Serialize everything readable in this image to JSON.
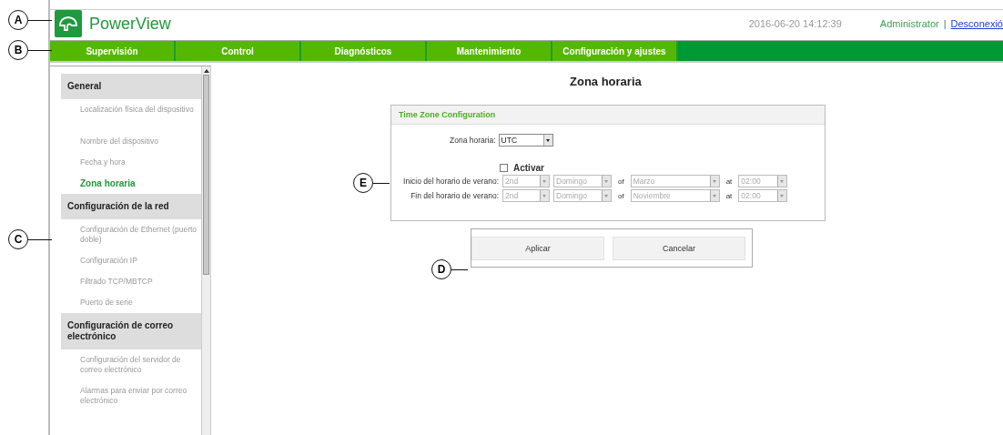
{
  "callouts": [
    "A",
    "B",
    "C",
    "D",
    "E"
  ],
  "header": {
    "brand": "PowerView",
    "datetime": "2016-06-20 14:12:39",
    "user": "Administrator",
    "separator": "|",
    "logout": "Desconexió"
  },
  "nav": [
    "Supervisión",
    "Control",
    "Diagnósticos",
    "Mantenimiento",
    "Configuración y ajustes"
  ],
  "sidebar": {
    "groups": [
      {
        "title": "General",
        "items": [
          {
            "label": "Localización física del dispositivo",
            "selected": false
          },
          {
            "label": "Nombre del dispositivo",
            "selected": false
          },
          {
            "label": "Fecha y hora",
            "selected": false
          },
          {
            "label": "Zona horaria",
            "selected": true
          }
        ]
      },
      {
        "title": "Configuración de la red",
        "items": [
          {
            "label": "Configuración de Ethernet (puerto doble)",
            "selected": false
          },
          {
            "label": "Configuración IP",
            "selected": false
          },
          {
            "label": "Filtrado TCP/MBTCP",
            "selected": false
          },
          {
            "label": "Puerto de serie",
            "selected": false
          }
        ]
      },
      {
        "title": "Configuración de correo electrónico",
        "items": [
          {
            "label": "Configuración del servidor de correo electrónico",
            "selected": false
          },
          {
            "label": "Alarmas para enviar por correo electrónico",
            "selected": false
          }
        ]
      }
    ]
  },
  "page_title": "Zona horaria",
  "panel": {
    "title": "Time Zone Configuration",
    "zone_label": "Zona horaria:",
    "zone_value": "UTC",
    "dst_label": "Activar",
    "dst_checked": false,
    "rows": [
      {
        "label": "Inicio del horario de verano:",
        "week": "2nd",
        "day": "Domingo",
        "of": "of",
        "month": "Marzo",
        "at": "at",
        "time": "02:00"
      },
      {
        "label": "Fin del horario de verano:",
        "week": "2nd",
        "day": "Domingo",
        "of": "of",
        "month": "Noviembre",
        "at": "at",
        "time": "02:00"
      }
    ]
  },
  "buttons": [
    "Aplicar",
    "Cancelar"
  ]
}
